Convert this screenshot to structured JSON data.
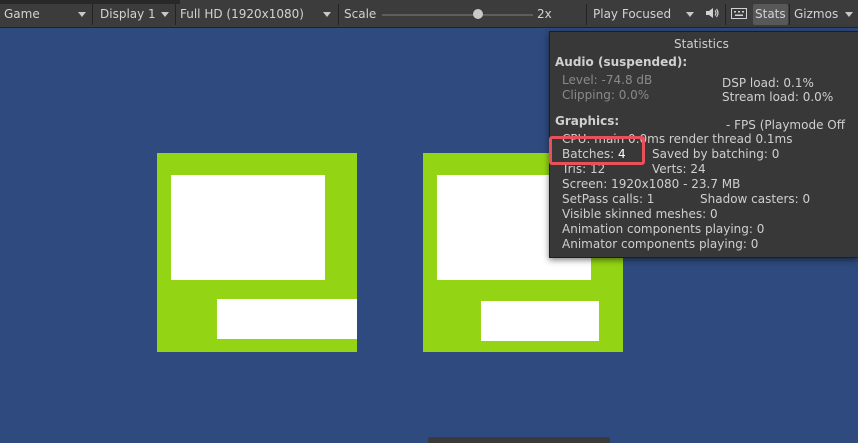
{
  "toolbar": {
    "view_label": "Game",
    "display_label": "Display 1",
    "resolution_label": "Full HD (1920x1080)",
    "scale_label": "Scale",
    "scale_value": "2x",
    "scale_level": 0.63,
    "play_mode_label": "Play Focused",
    "stats_label": "Stats",
    "gizmos_label": "Gizmos"
  },
  "statistics": {
    "title": "Statistics",
    "audio_header": "Audio (suspended):",
    "level": "Level: -74.8 dB",
    "clipping": "Clipping: 0.0%",
    "dsp_load": "DSP load: 0.1%",
    "stream_load": "Stream load: 0.0%",
    "graphics_header": "Graphics:",
    "fps": "- FPS (Playmode Off",
    "cpu": "CPU: main 0.0ms  render thread 0.1ms",
    "batches_label": "Batches:",
    "batches_value": "4",
    "saved_by_batching": "Saved by batching: 0",
    "tris": "Tris: 12",
    "verts": "Verts: 24",
    "screen": "Screen: 1920x1080 - 23.7 MB",
    "setpass": "SetPass calls: 1",
    "shadow_casters": "Shadow casters: 0",
    "skinned_meshes": "Visible skinned meshes: 0",
    "animation_components": "Animation components playing: 0",
    "animator_components": "Animator components playing: 0"
  },
  "colors": {
    "scene_background": "#2f4a7e",
    "panel_green": "#93d414",
    "highlight": "#e8505b"
  }
}
